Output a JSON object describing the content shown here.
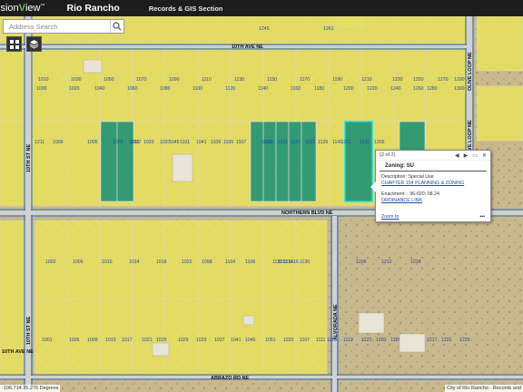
{
  "header": {
    "logo_prefix": "ision",
    "logo_v": "V",
    "logo_suffix": "iew",
    "logo_tm": "™",
    "city": "Rio Rancho",
    "section": "Records & GIS Section"
  },
  "search": {
    "placeholder": "Address Search"
  },
  "tools": {
    "grid_icon": "grid-icon",
    "layers_icon": "layers-icon"
  },
  "streets": {
    "tenth_ave": "10TH AVE NE",
    "northern_blvd": "NORTHERN BLVD NE",
    "abrazo_rd": "ABRAZO RD NE",
    "tenth_st": "10TH ST NE",
    "olive_loop": "OLIVE LOOP NE",
    "alvorada": "ALVORADA NE",
    "tenth_ave_left": "10TH AVE NE"
  },
  "colors": {
    "zoned": "#e8e061",
    "special_use": "#23947a",
    "road": "#2f6fb4",
    "selection": "#00e5ff"
  },
  "parcels": {
    "top_row": [
      "1245",
      "1261"
    ],
    "row1": [
      "1010",
      "1030",
      "1050",
      "1070",
      "1090",
      "1110",
      "1130",
      "1150",
      "1170",
      "1190",
      "1210",
      "1230",
      "1250",
      "1270",
      "1290"
    ],
    "row2": [
      "1000",
      "1020",
      "1040",
      "1060",
      "1080",
      "1100",
      "1120",
      "1140",
      "1160",
      "1180",
      "1200",
      "1220",
      "1240",
      "1260",
      "1280",
      "1300"
    ],
    "row3": [
      "1025",
      "1031",
      "1045",
      "1101",
      "1109",
      "1107",
      "1125",
      "1127",
      "1129",
      "1141",
      "1143",
      "1205",
      "1211",
      "1009",
      "1005",
      "1017",
      "1033",
      "1037",
      "1041",
      "1105",
      "1113",
      "1121",
      "1123",
      "1101"
    ],
    "row4": [
      "1002",
      "1006",
      "1010",
      "1014",
      "1018",
      "1022",
      "1098",
      "1104",
      "1108",
      "1110",
      "1112",
      "1114",
      "1116",
      "1130",
      "1206",
      "1212",
      "1218"
    ],
    "row5": [
      "1001",
      "1005",
      "1009",
      "1013",
      "1017",
      "1021",
      "1025",
      "1029",
      "1033",
      "1037",
      "1041",
      "1045",
      "1051",
      "1103",
      "1107",
      "1111",
      "1115",
      "1119",
      "1123",
      "1201",
      "1205",
      "1213",
      "1217",
      "1221",
      "1225"
    ]
  },
  "popup": {
    "counter": "(2 of 2)",
    "prev_icon": "prev-icon",
    "next_icon": "next-icon",
    "minimize_icon": "minimize-icon",
    "close_icon": "close-icon",
    "title": "Zoning: SU",
    "description": "Description: Special Use",
    "chapter_link": "CHAPTER 154 PLANNING & ZONING",
    "enactment": "Enactment: ; 96-020; 08.24",
    "ordinance_link": "ORDINANCE LINK",
    "zoom_link": "Zoom to",
    "more": "•••"
  },
  "footer": {
    "coords": "-106.714 35.276 Degrees",
    "attribution": "City of Rio Rancho - Records and"
  }
}
